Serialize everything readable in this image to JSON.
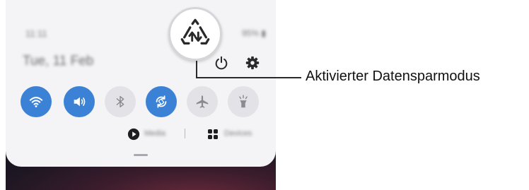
{
  "status_bar": {
    "time": "11:11",
    "battery": "95% ▮"
  },
  "panel": {
    "date": "Tue, 11 Feb",
    "quick_toggles": [
      {
        "name": "Wi-Fi",
        "icon": "wifi-icon",
        "on": true
      },
      {
        "name": "Sound",
        "icon": "sound-icon",
        "on": true
      },
      {
        "name": "Bluetooth",
        "icon": "bluetooth-icon",
        "on": false
      },
      {
        "name": "Auto rotate",
        "icon": "auto-rotate-icon",
        "on": true
      },
      {
        "name": "Airplane mode",
        "icon": "airplane-icon",
        "on": false
      },
      {
        "name": "Flashlight",
        "icon": "flashlight-icon",
        "on": false
      }
    ],
    "media_label": "Media",
    "devices_label": "Devices",
    "header_icons": [
      "power-icon",
      "settings-gear-icon"
    ]
  },
  "magnified_icon": "data-saver-icon",
  "callout": {
    "label": "Aktivierter Datensparmodus"
  },
  "colors": {
    "toggle_on": "#3b82d6",
    "toggle_off": "#e3e3e7",
    "panel_bg": "#f4f4f6",
    "icon_dark": "#2a2a2a"
  }
}
